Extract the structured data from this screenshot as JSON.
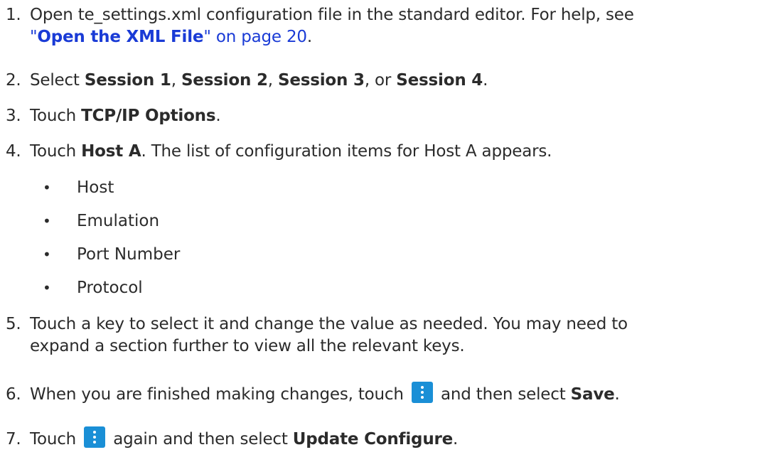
{
  "steps": [
    {
      "num": "1.",
      "line1": "Open te_settings.xml configuration file in the standard editor. For help, see",
      "q1": "\"",
      "link_bold": "Open the XML File",
      "q2": "\"",
      "link_tail": " on page 20",
      "end": "."
    },
    {
      "num": "2.",
      "pre": "Select ",
      "s1": "Session 1",
      "c1": ", ",
      "s2": "Session 2",
      "c2": ", ",
      "s3": "Session 3",
      "c3": ", or ",
      "s4": "Session 4",
      "end": "."
    },
    {
      "num": "3.",
      "pre": "Touch ",
      "bold": "TCP/IP Options",
      "end": "."
    },
    {
      "num": "4.",
      "pre": "Touch ",
      "bold": "Host A",
      "rest": ". The list of configuration items for Host A appears."
    },
    {
      "num": "5.",
      "line1": "Touch a key to select it and change the value as needed. You may need to",
      "line2": "expand a section further to view all the relevant keys."
    },
    {
      "num": "6.",
      "pre": "When you are finished making changes, touch ",
      "mid": " and then select ",
      "bold": "Save",
      "end": "."
    },
    {
      "num": "7.",
      "pre": "Touch ",
      "mid": " again and then select ",
      "bold": "Update Configure",
      "end": "."
    }
  ],
  "bullets": [
    "Host",
    "Emulation",
    "Port Number",
    "Protocol"
  ],
  "bullet_glyph": "•",
  "icons": {
    "menu": "more-vert-icon",
    "menu_color": "#1a8fd6",
    "link_color": "#1a3bd6"
  }
}
